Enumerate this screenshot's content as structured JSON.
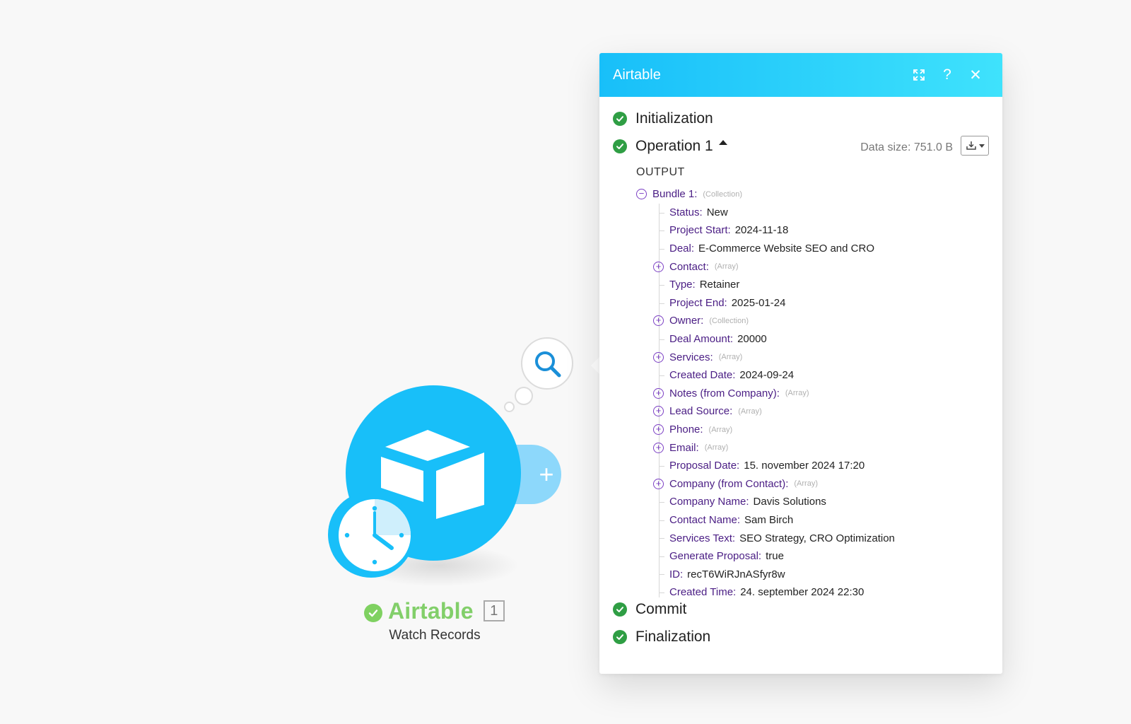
{
  "module": {
    "name": "Airtable",
    "run_count": "1",
    "subtitle": "Watch Records",
    "icons": [
      "airtable-box-icon",
      "clock-icon",
      "search-icon",
      "plus-icon",
      "check-icon"
    ]
  },
  "panel": {
    "title": "Airtable",
    "header_icons": [
      "expand-icon",
      "help-icon",
      "close-icon"
    ],
    "stages": {
      "initialization": "Initialization",
      "operation": "Operation 1",
      "commit": "Commit",
      "finalization": "Finalization"
    },
    "data_size": "Data size: 751.0 B",
    "output_label": "OUTPUT",
    "bundle": {
      "label": "Bundle 1:",
      "type": "(Collection)",
      "fields": [
        {
          "key": "Status:",
          "value": "New"
        },
        {
          "key": "Project Start:",
          "value": "2024-11-18"
        },
        {
          "key": "Deal:",
          "value": "E-Commerce Website SEO and CRO"
        },
        {
          "key": "Contact:",
          "type": "(Array)"
        },
        {
          "key": "Type:",
          "value": "Retainer"
        },
        {
          "key": "Project End:",
          "value": "2025-01-24"
        },
        {
          "key": "Owner:",
          "type": "(Collection)"
        },
        {
          "key": "Deal Amount:",
          "value": "20000"
        },
        {
          "key": "Services:",
          "type": "(Array)"
        },
        {
          "key": "Created Date:",
          "value": "2024-09-24"
        },
        {
          "key": "Notes (from Company):",
          "type": "(Array)"
        },
        {
          "key": "Lead Source:",
          "type": "(Array)"
        },
        {
          "key": "Phone:",
          "type": "(Array)"
        },
        {
          "key": "Email:",
          "type": "(Array)"
        },
        {
          "key": "Proposal Date:",
          "value": "15. november 2024 17:20"
        },
        {
          "key": "Company (from Contact):",
          "type": "(Array)"
        },
        {
          "key": "Company Name:",
          "value": "Davis Solutions"
        },
        {
          "key": "Contact Name:",
          "value": "Sam Birch"
        },
        {
          "key": "Services Text:",
          "value": "SEO Strategy, CRO Optimization"
        },
        {
          "key": "Generate Proposal:",
          "value": "true"
        },
        {
          "key": "ID:",
          "value": "recT6WiRJnASfyr8w"
        },
        {
          "key": "Created Time:",
          "value": "24. september 2024 22:30"
        }
      ]
    }
  },
  "colors": {
    "airtable_blue": "#18bff9",
    "header_gradient_end": "#3fe2fc",
    "success_green": "#2f9e44",
    "label_green": "#82cf6a",
    "key_purple": "#4a1d84"
  }
}
